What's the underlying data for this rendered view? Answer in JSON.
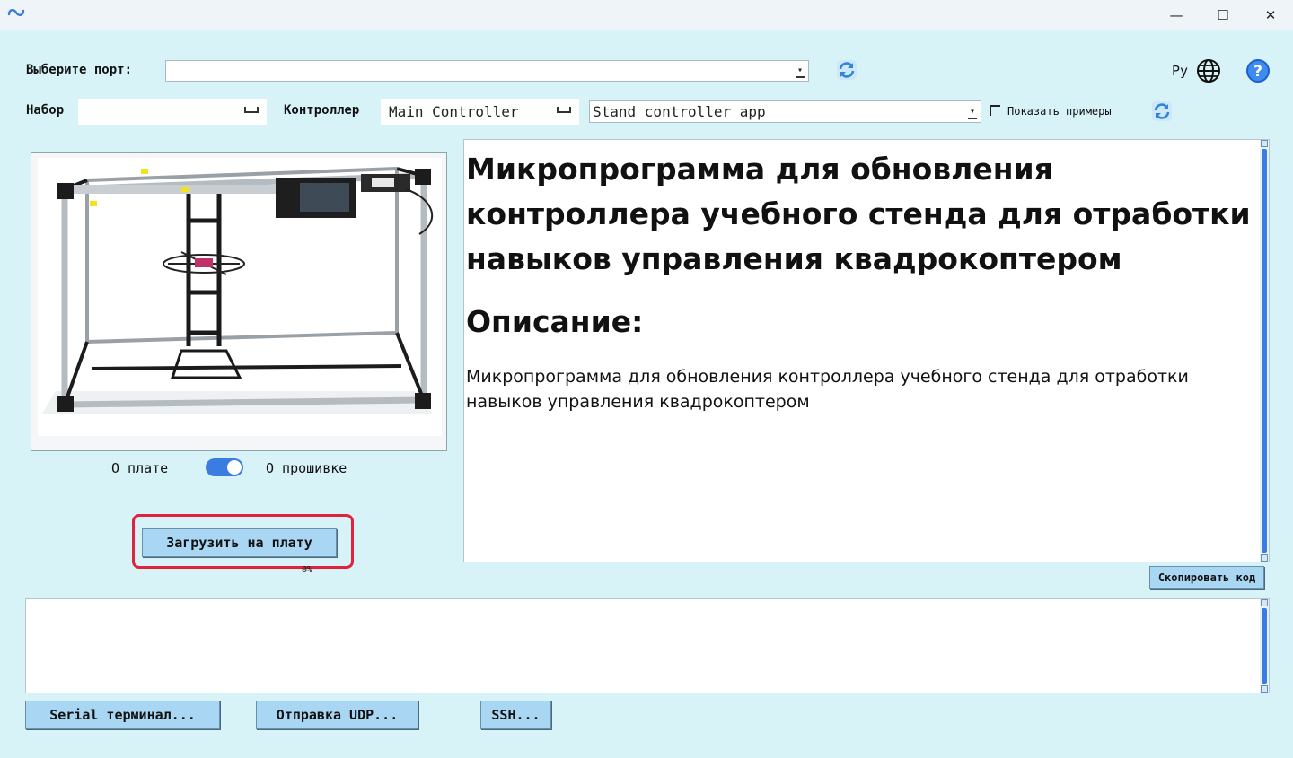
{
  "window": {
    "minimize_glyph": "—",
    "maximize_glyph": "☐",
    "close_glyph": "✕"
  },
  "port": {
    "label": "Выберите порт:",
    "value": ""
  },
  "language": {
    "label": "Ру"
  },
  "kit": {
    "label": "Набор",
    "value": ""
  },
  "controller": {
    "label": "Контроллер",
    "value": "Main Controller"
  },
  "firmware": {
    "value": "Stand controller app"
  },
  "show_examples": {
    "label": "Показать примеры",
    "checked": false
  },
  "toggle": {
    "left_label": "О плате",
    "right_label": "О прошивке",
    "state": "right"
  },
  "upload": {
    "label": "Загрузить на плату",
    "progress_text": "0%",
    "highlight_color": "#e0223c"
  },
  "description": {
    "title": "Микропрограмма для обновления контроллера учебного стенда для отработки навыков управления квадрокоптером",
    "section_heading": "Описание:",
    "text": "Микропрограмма для обновления контроллера учебного стенда для отработки навыков управления квадрокоптером"
  },
  "copy_code": {
    "label": "Скопировать код"
  },
  "log": {
    "text": ""
  },
  "bottom_buttons": {
    "serial": "Serial терминал...",
    "udp": "Отправка UDP...",
    "ssh": "SSH..."
  },
  "icons": {
    "refresh": "refresh-icon",
    "globe": "globe-icon",
    "help": "help-icon",
    "logo": "app-logo-icon"
  },
  "colors": {
    "background": "#d8f3f8",
    "button": "#a9d6f3",
    "accent_blue": "#3b7ce0"
  }
}
